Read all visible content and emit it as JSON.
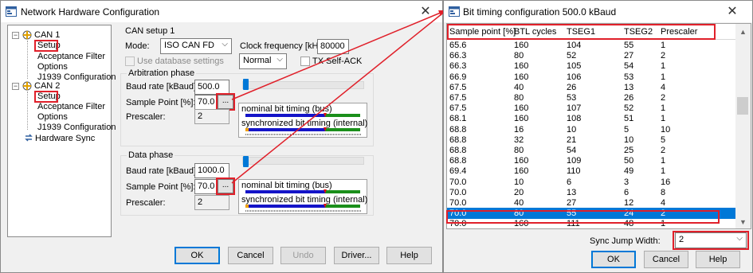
{
  "colors": {
    "accent": "#0078d7",
    "highlight": "#e0202a",
    "timing_green": "#1a8f1a",
    "timing_blue": "#1414c8",
    "timing_red": "#e01010",
    "timing_orange": "#f0a000"
  },
  "main_window": {
    "title": "Network Hardware Configuration",
    "close_label": "✕",
    "tree": [
      {
        "label": "CAN 1",
        "icon": "can-network-icon",
        "expander": "−"
      },
      {
        "label": "Setup"
      },
      {
        "label": "Acceptance Filter"
      },
      {
        "label": "Options"
      },
      {
        "label": "J1939 Configuration"
      },
      {
        "label": "CAN 2",
        "icon": "can-network-icon",
        "expander": "−"
      },
      {
        "label": "Setup"
      },
      {
        "label": "Acceptance Filter"
      },
      {
        "label": "Options"
      },
      {
        "label": "J1939 Configuration"
      },
      {
        "label": "Hardware Sync",
        "icon": "sync-icon"
      }
    ],
    "can_setup": {
      "heading": "CAN setup 1",
      "mode_label": "Mode:",
      "mode_value": "ISO CAN FD",
      "use_db_label": "Use database settings",
      "clock_label": "Clock frequency [kHz]:",
      "clock_value": "80000",
      "sample_mode_value": "Normal",
      "tx_self_ack_label": "TX Self-ACK"
    },
    "arbitration": {
      "title": "Arbitration phase",
      "baud_label": "Baud rate [kBaud]:",
      "baud_value": "500.0",
      "sample_label": "Sample Point [%]:",
      "sample_value": "70.0",
      "prescaler_label": "Prescaler:",
      "prescaler_value": "2",
      "nominal_label": "nominal bit timing (bus)",
      "sync_label": "synchronized bit timing (internal)",
      "slider_level": 0.0
    },
    "data_phase": {
      "title": "Data phase",
      "baud_label": "Baud rate [kBaud]:",
      "baud_value": "1000.0",
      "sample_label": "Sample Point [%]:",
      "sample_value": "70.0",
      "prescaler_label": "Prescaler:",
      "prescaler_value": "2",
      "nominal_label": "nominal bit timing (bus)",
      "sync_label": "synchronized bit timing (internal)",
      "slider_level": 0.0
    },
    "dots_label": "...",
    "buttons": {
      "ok": "OK",
      "cancel": "Cancel",
      "undo": "Undo",
      "driver": "Driver...",
      "help": "Help"
    }
  },
  "timing_dialog": {
    "title": "Bit timing configuration 500.0 kBaud",
    "close_label": "✕",
    "columns": [
      "Sample point [%]",
      "BTL cycles",
      "TSEG1",
      "TSEG2",
      "Prescaler"
    ],
    "rows": [
      [
        "65.6",
        "160",
        "104",
        "55",
        "1"
      ],
      [
        "66.3",
        "80",
        "52",
        "27",
        "2"
      ],
      [
        "66.3",
        "160",
        "105",
        "54",
        "1"
      ],
      [
        "66.9",
        "160",
        "106",
        "53",
        "1"
      ],
      [
        "67.5",
        "40",
        "26",
        "13",
        "4"
      ],
      [
        "67.5",
        "80",
        "53",
        "26",
        "2"
      ],
      [
        "67.5",
        "160",
        "107",
        "52",
        "1"
      ],
      [
        "68.1",
        "160",
        "108",
        "51",
        "1"
      ],
      [
        "68.8",
        "16",
        "10",
        "5",
        "10"
      ],
      [
        "68.8",
        "32",
        "21",
        "10",
        "5"
      ],
      [
        "68.8",
        "80",
        "54",
        "25",
        "2"
      ],
      [
        "68.8",
        "160",
        "109",
        "50",
        "1"
      ],
      [
        "69.4",
        "160",
        "110",
        "49",
        "1"
      ],
      [
        "70.0",
        "10",
        "6",
        "3",
        "16"
      ],
      [
        "70.0",
        "20",
        "13",
        "6",
        "8"
      ],
      [
        "70.0",
        "40",
        "27",
        "12",
        "4"
      ],
      [
        "70.0",
        "80",
        "55",
        "24",
        "2"
      ],
      [
        "70.0",
        "160",
        "111",
        "48",
        "1"
      ]
    ],
    "selected_row": 16,
    "sjw_label": "Sync Jump Width:",
    "sjw_value": "2",
    "buttons": {
      "ok": "OK",
      "cancel": "Cancel",
      "help": "Help"
    }
  }
}
